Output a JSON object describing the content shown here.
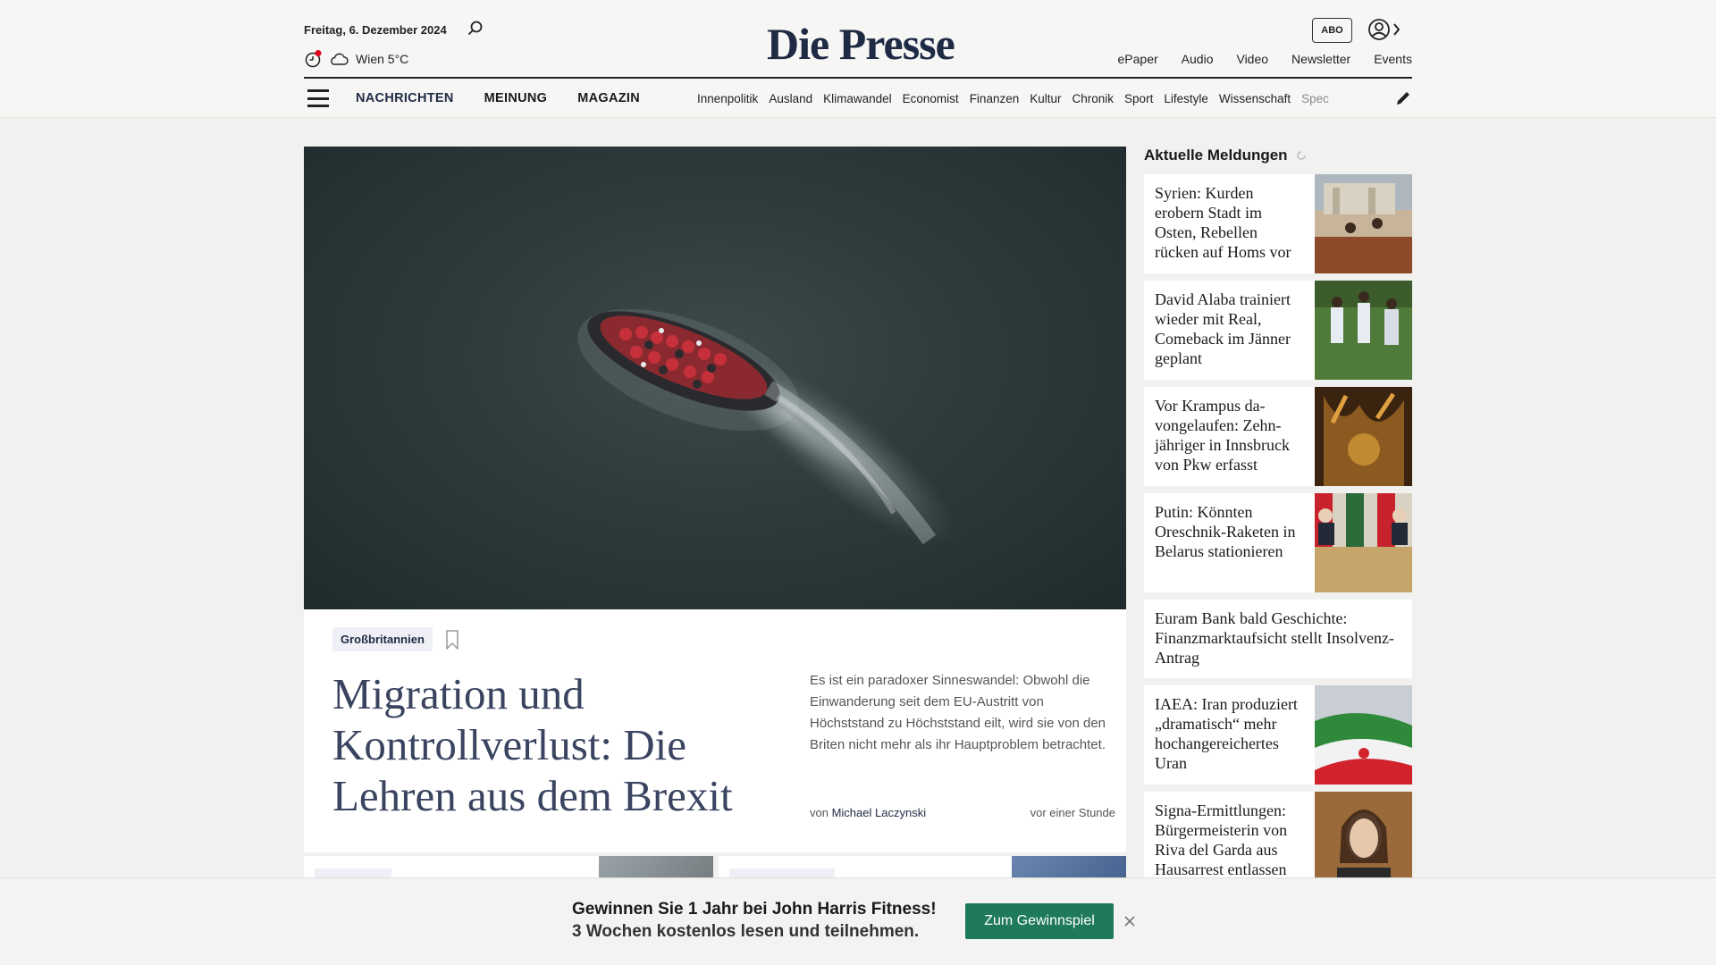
{
  "header": {
    "date": "Freitag, 6. Dezember 2024",
    "weather": "Wien 5°C",
    "logo": "Die Presse",
    "abo_label": "ABO",
    "service_links": [
      "ePaper",
      "Audio",
      "Video",
      "Newsletter",
      "Events"
    ]
  },
  "nav": {
    "main": [
      "NACHRICHTEN",
      "MEINUNG",
      "MAGAZIN"
    ],
    "sub": [
      "Innenpolitik",
      "Ausland",
      "Klimawandel",
      "Economist",
      "Finanzen",
      "Kultur",
      "Chronik",
      "Sport",
      "Lifestyle",
      "Wissenschaft",
      "Spec"
    ]
  },
  "hero": {
    "tag": "Großbritannien",
    "title": "Migration und Kontrollverlust: Die Lehren aus dem Brexit",
    "teaser": "Es ist ein paradoxer Sinneswandel: Obwohl die Einwanderung seit dem EU-Austritt von Höchststand zu Höchststand eilt, wird sie von den Briten nicht mehr als ihr Hauptproblem betrachtet.",
    "byline_prefix": "von",
    "author": "Michael Laczynski",
    "timestamp": "vor einer Stunde"
  },
  "sidebar": {
    "title": "Aktuelle Meldungen",
    "items": [
      {
        "text": "Syrien: Kurden erobern Stadt im Osten, Rebellen rücken auf Homs vor"
      },
      {
        "text": "David Alaba trainiert wieder mit Real, Comeback im Jänner geplant"
      },
      {
        "text": "Vor Krampus da­vongelaufen: Zehn­jähriger in Innsbruck von Pkw erfasst"
      },
      {
        "text": "Putin: Könnten Oreschnik-Raketen in Belarus stationieren"
      },
      {
        "text": "Euram Bank bald Geschichte: Finanzmarktaufsicht stellt Insolvenz-Antrag"
      },
      {
        "text": "IAEA: Iran produziert „drama­tisch“ mehr hochan­gereichertes Uran"
      },
      {
        "text": "Signa-Ermittlungen: Bürgermeisterin von Riva del Garda aus Hausarrest entlassen"
      }
    ]
  },
  "promo": {
    "line1": "Gewinnen Sie 1 Jahr bei John Harris Fitness!",
    "line2": "3 Wochen kostenlos lesen und teilnehmen.",
    "button": "Zum Gewinnspiel"
  },
  "colors": {
    "brand": "#1f2a44",
    "promo_button": "#1e7a5a",
    "notification_dot": "#e2001a"
  }
}
